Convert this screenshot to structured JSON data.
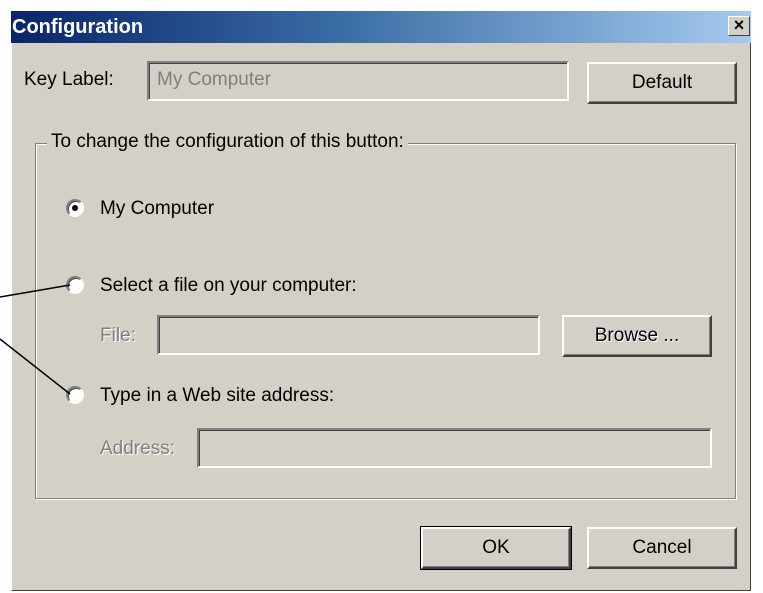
{
  "window": {
    "title": "Configuration",
    "close_glyph": "×"
  },
  "key_label": {
    "label": "Key Label:",
    "value": "My Computer",
    "default_button": "Default"
  },
  "group": {
    "legend": "To change the configuration of this button:",
    "options": [
      {
        "label": "My Computer",
        "selected": true
      },
      {
        "label": "Select a file on your computer:",
        "selected": false
      },
      {
        "label": "Type in a Web site address:",
        "selected": false
      }
    ],
    "file": {
      "label": "File:",
      "value": "",
      "browse_button": "Browse ..."
    },
    "address": {
      "label": "Address:",
      "value": ""
    }
  },
  "footer": {
    "ok_button": "OK",
    "cancel_button": "Cancel"
  }
}
